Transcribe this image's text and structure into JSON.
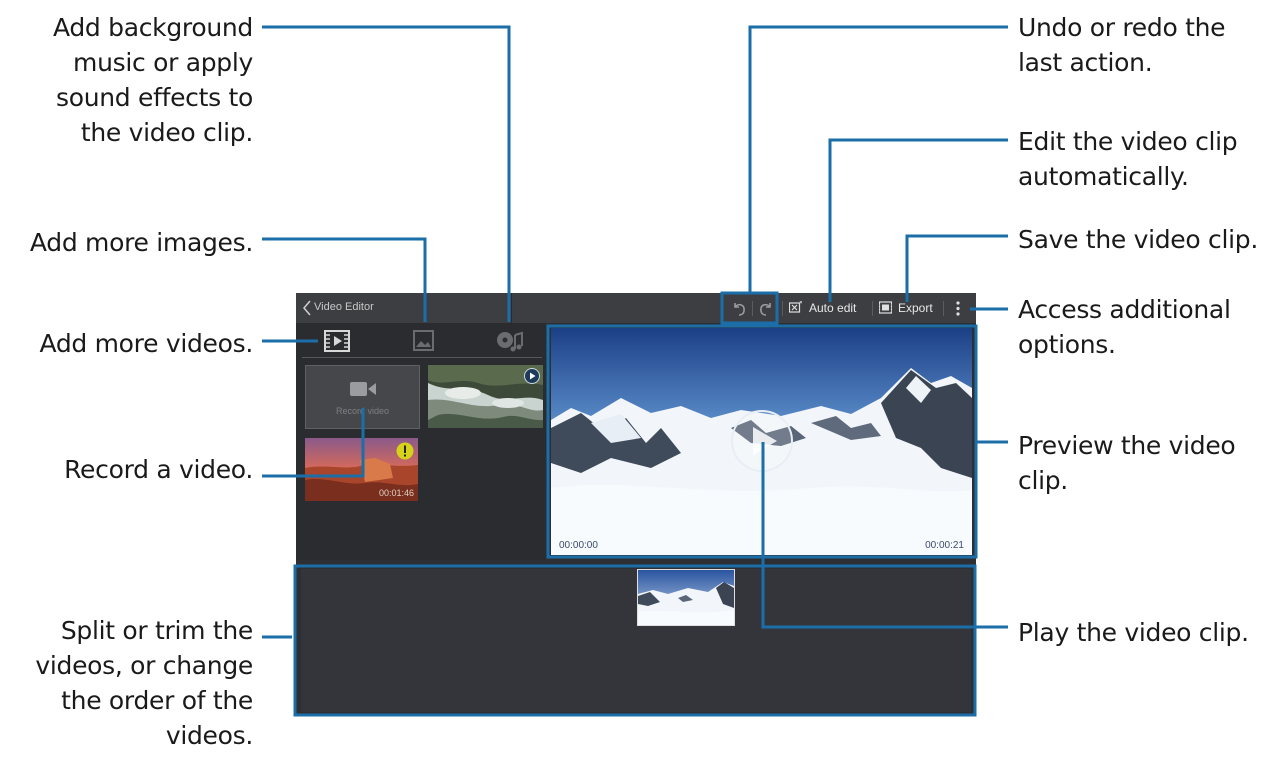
{
  "callouts": {
    "add_music": "Add background music or apply sound effects to the video clip.",
    "add_images": "Add more images.",
    "add_videos": "Add more videos.",
    "record_video": "Record a video.",
    "split_trim": "Split or trim the videos, or change the order of the videos.",
    "undo_redo": "Undo or redo the last action.",
    "auto_edit": "Edit the video clip automatically.",
    "save_clip": "Save the video clip.",
    "more_options": "Access additional options.",
    "preview_clip": "Preview the video clip.",
    "play_clip": "Play the video clip."
  },
  "app": {
    "title": "Video Editor",
    "auto_edit_label": "Auto edit",
    "export_label": "Export",
    "record_label": "Record video",
    "thumb2_duration": "00:01:46",
    "preview_time_start": "00:00:00",
    "preview_time_end": "00:00:21"
  },
  "icons": [
    "back-chevron-icon",
    "undo-icon",
    "redo-icon",
    "auto-edit-icon",
    "export-icon",
    "more-options-icon",
    "video-tab-icon",
    "image-tab-icon",
    "music-tab-icon",
    "camcorder-icon",
    "play-badge-icon",
    "warning-badge-icon",
    "play-icon"
  ],
  "colors": {
    "line": "#1b6ea8",
    "ui_bg": "#2d2f33",
    "actionbar": "#3c3e42"
  }
}
